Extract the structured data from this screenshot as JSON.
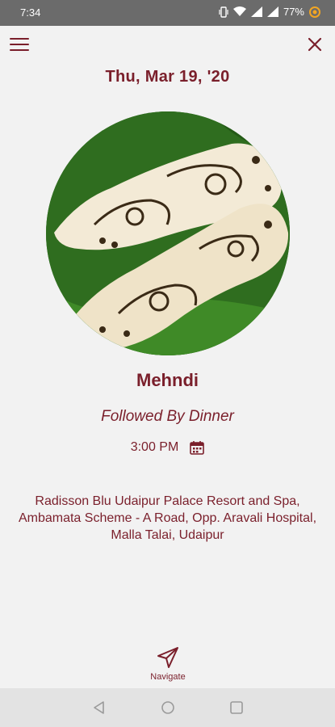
{
  "status_bar": {
    "time": "7:34",
    "battery": "77%"
  },
  "header": {
    "menu_icon": "hamburger-menu-icon",
    "close_icon": "close-icon"
  },
  "event": {
    "date": "Thu, Mar 19, '20",
    "title": "Mehndi",
    "subtitle": "Followed By Dinner",
    "time": "3:00 PM",
    "address": "Radisson Blu Udaipur Palace Resort and Spa, Ambamata Scheme - A Road, Opp. Aravali Hospital, Malla Talai, Udaipur"
  },
  "navigate": {
    "label": "Navigate",
    "icon": "navigation-arrow-icon"
  },
  "colors": {
    "accent": "#7a1f2b",
    "background": "#f2f2f2",
    "statusbar": "#6b6b6b"
  }
}
